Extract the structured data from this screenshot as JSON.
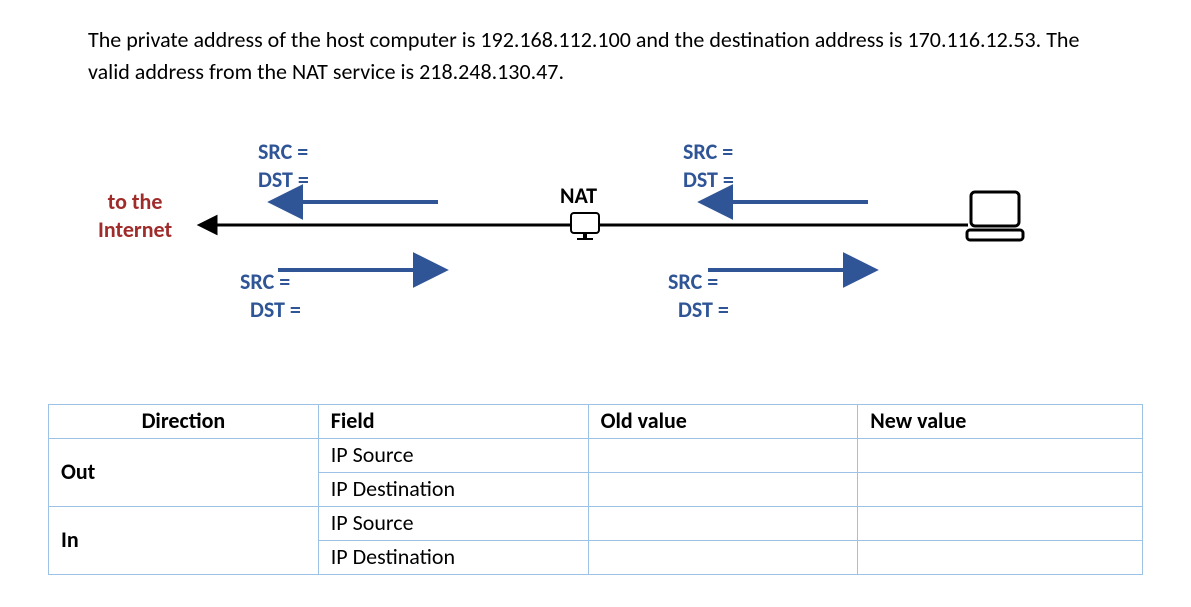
{
  "intro_text": "The private address of the host computer is 192.168.112.100 and the destination address is 170.116.12.53. The valid address from the NAT service is 218.248.130.47.",
  "diagram": {
    "left_label": "to the\nInternet",
    "nat_label": "NAT",
    "top_left": "SRC =\nDST =",
    "top_right": "SRC =\nDST =",
    "bottom_left": "SRC =\n  DST =",
    "bottom_right": "SRC =\n  DST =",
    "colors": {
      "blue": "#2f5597",
      "maroon": "#a02b2b"
    }
  },
  "table": {
    "headers": {
      "direction": "Direction",
      "field": "Field",
      "old": "Old value",
      "new": "New value"
    },
    "rows": [
      {
        "direction": "Out",
        "field": "IP Source",
        "old": "",
        "new": ""
      },
      {
        "direction": "",
        "field": "IP Destination",
        "old": "",
        "new": ""
      },
      {
        "direction": "In",
        "field": "IP Source",
        "old": "",
        "new": ""
      },
      {
        "direction": "",
        "field": "IP Destination",
        "old": "",
        "new": ""
      }
    ]
  },
  "chart_data": {
    "type": "table",
    "title": "NAT translation table",
    "columns": [
      "Direction",
      "Field",
      "Old value",
      "New value"
    ],
    "rows": [
      [
        "Out",
        "IP Source",
        "",
        ""
      ],
      [
        "Out",
        "IP Destination",
        "",
        ""
      ],
      [
        "In",
        "IP Source",
        "",
        ""
      ],
      [
        "In",
        "IP Destination",
        "",
        ""
      ]
    ],
    "context": {
      "private_address": "192.168.112.100",
      "destination_address": "170.116.12.53",
      "nat_public_address": "218.248.130.47"
    }
  }
}
